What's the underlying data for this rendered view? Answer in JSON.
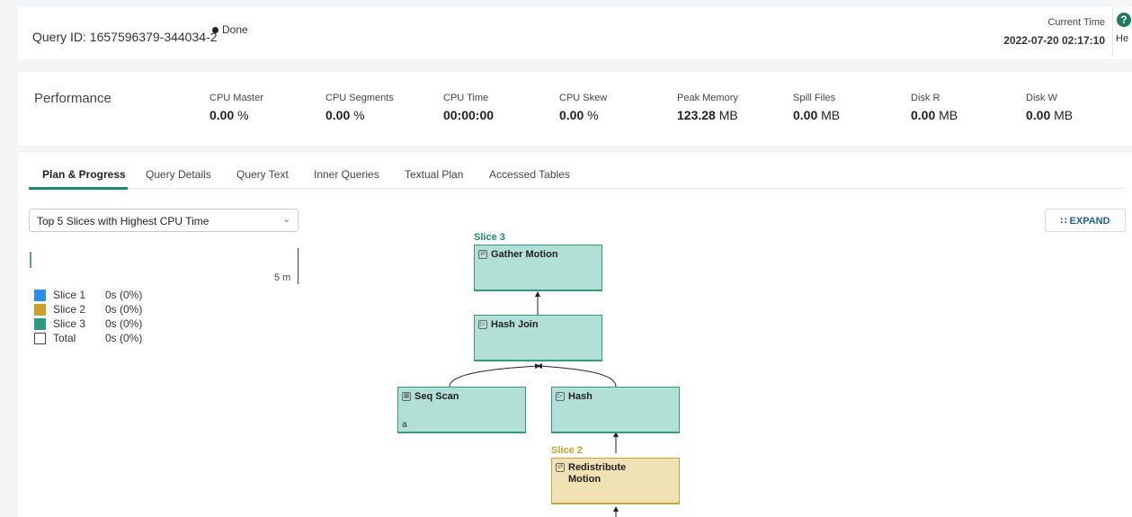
{
  "header": {
    "query_id": "Query ID: 1657596379-344034-2",
    "status": "Done",
    "current_time_label": "Current Time",
    "current_time_value": "2022-07-20 02:17:10",
    "help_label": "He"
  },
  "performance": {
    "title": "Performance",
    "metrics": [
      {
        "label": "CPU Master",
        "value": "0.00",
        "unit": "%"
      },
      {
        "label": "CPU Segments",
        "value": "0.00",
        "unit": "%"
      },
      {
        "label": "CPU Time",
        "value": "00:00:00",
        "unit": ""
      },
      {
        "label": "CPU Skew",
        "value": "0.00",
        "unit": "%"
      },
      {
        "label": "Peak Memory",
        "value": "123.28",
        "unit": "MB"
      },
      {
        "label": "Spill Files",
        "value": "0.00",
        "unit": "MB"
      },
      {
        "label": "Disk R",
        "value": "0.00",
        "unit": "MB"
      },
      {
        "label": "Disk W",
        "value": "0.00",
        "unit": "MB"
      }
    ]
  },
  "tabs": [
    "Plan & Progress",
    "Query Details",
    "Query Text",
    "Inner Queries",
    "Textual Plan",
    "Accessed Tables"
  ],
  "active_tab": 0,
  "slice_select": {
    "value": "Top 5 Slices with Highest CPU Time"
  },
  "expand_label": "EXPAND",
  "timeline": {
    "scale_label": "5 m"
  },
  "legend": [
    {
      "name": "Slice 1",
      "value": "0s (0%)",
      "color": "#2b8de8"
    },
    {
      "name": "Slice 2",
      "value": "0s (0%)",
      "color": "#c9a02a"
    },
    {
      "name": "Slice 3",
      "value": "0s (0%)",
      "color": "#2a9a82"
    },
    {
      "name": "Total",
      "value": "0s (0%)",
      "color": "#ffffff"
    }
  ],
  "plan": {
    "slice3_label": "Slice 3",
    "slice2_label": "Slice 2",
    "slice3_color": "#1a8a6a",
    "slice2_color": "#c9a02a",
    "nodes": {
      "gather_motion": {
        "title": "Gather Motion"
      },
      "hash_join": {
        "title": "Hash Join"
      },
      "seq_scan": {
        "title": "Seq Scan",
        "sub": "a"
      },
      "hash": {
        "title": "Hash"
      },
      "redistribute_motion": {
        "title": "Redistribute Motion"
      }
    }
  }
}
